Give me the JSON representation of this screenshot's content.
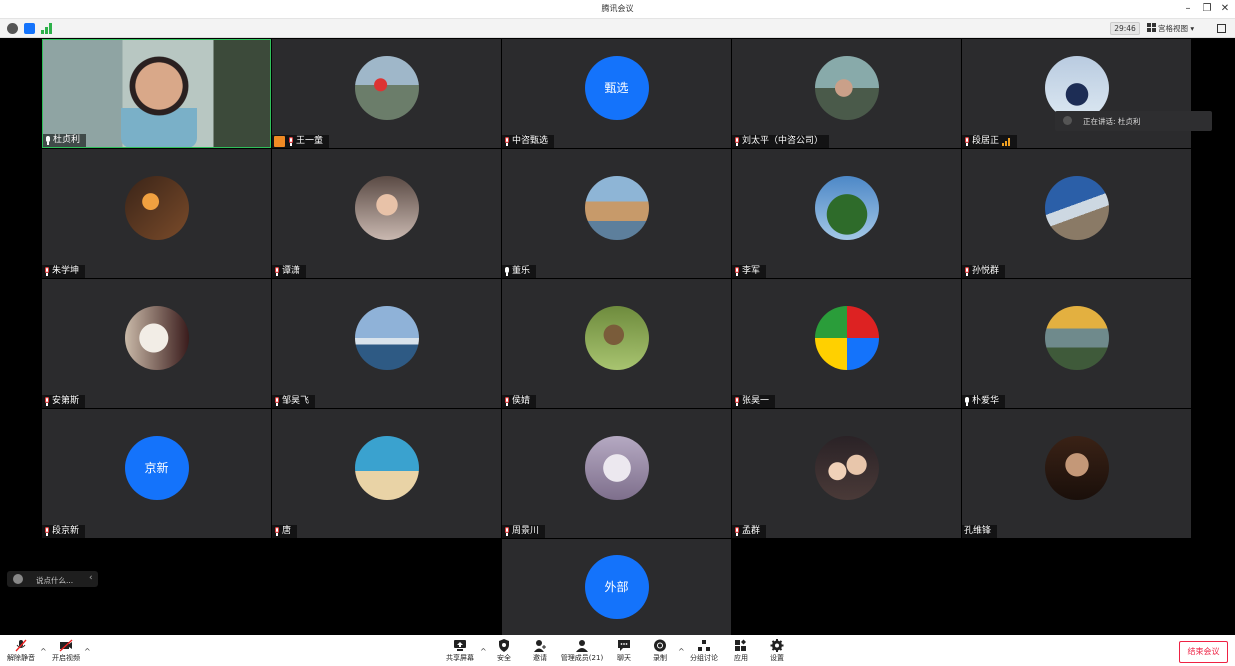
{
  "window": {
    "title": "腾讯会议"
  },
  "status": {
    "timer": "29:46",
    "view_label": "宫格视图"
  },
  "speaking": {
    "label": "正在讲话: 杜贞利"
  },
  "chat": {
    "placeholder": "说点什么...",
    "arrow": "‹"
  },
  "tiles": [
    {
      "name": "杜贞利",
      "kind": "video"
    },
    {
      "name": "王一童",
      "kind": "photo",
      "host": true
    },
    {
      "name": "中咨甄选",
      "kind": "text",
      "avatar_text": "甄选"
    },
    {
      "name": "刘太平（中咨公司）",
      "kind": "photo"
    },
    {
      "name": "段居正",
      "kind": "photo",
      "signal": true
    },
    {
      "name": "朱学坤",
      "kind": "photo"
    },
    {
      "name": "谭潇",
      "kind": "photo"
    },
    {
      "name": "董乐",
      "kind": "photo"
    },
    {
      "name": "李军",
      "kind": "photo"
    },
    {
      "name": "孙悦群",
      "kind": "photo"
    },
    {
      "name": "安第斯",
      "kind": "photo"
    },
    {
      "name": "邹昊飞",
      "kind": "photo"
    },
    {
      "name": "侯婧",
      "kind": "photo"
    },
    {
      "name": "张昊一",
      "kind": "photo"
    },
    {
      "name": "朴爱华",
      "kind": "photo"
    },
    {
      "name": "段京新",
      "kind": "text",
      "avatar_text": "京新"
    },
    {
      "name": "唐",
      "kind": "photo"
    },
    {
      "name": "周景川",
      "kind": "photo"
    },
    {
      "name": "孟群",
      "kind": "photo"
    },
    {
      "name": "孔维锋",
      "kind": "photo",
      "nomic": true
    },
    {
      "name": "",
      "kind": "text",
      "avatar_text": "外部"
    }
  ],
  "toolbar": {
    "unmute": "解除静音",
    "start_video": "开启视频",
    "share": "共享屏幕",
    "security": "安全",
    "invite": "邀请",
    "members": "管理成员(21)",
    "chat": "聊天",
    "record": "录制",
    "breakout": "分组讨论",
    "apps": "应用",
    "settings": "设置",
    "end": "结束会议"
  },
  "colors": {
    "accent": "#1473fb",
    "tile_bg": "#2b2b2d",
    "end": "#e22244"
  }
}
